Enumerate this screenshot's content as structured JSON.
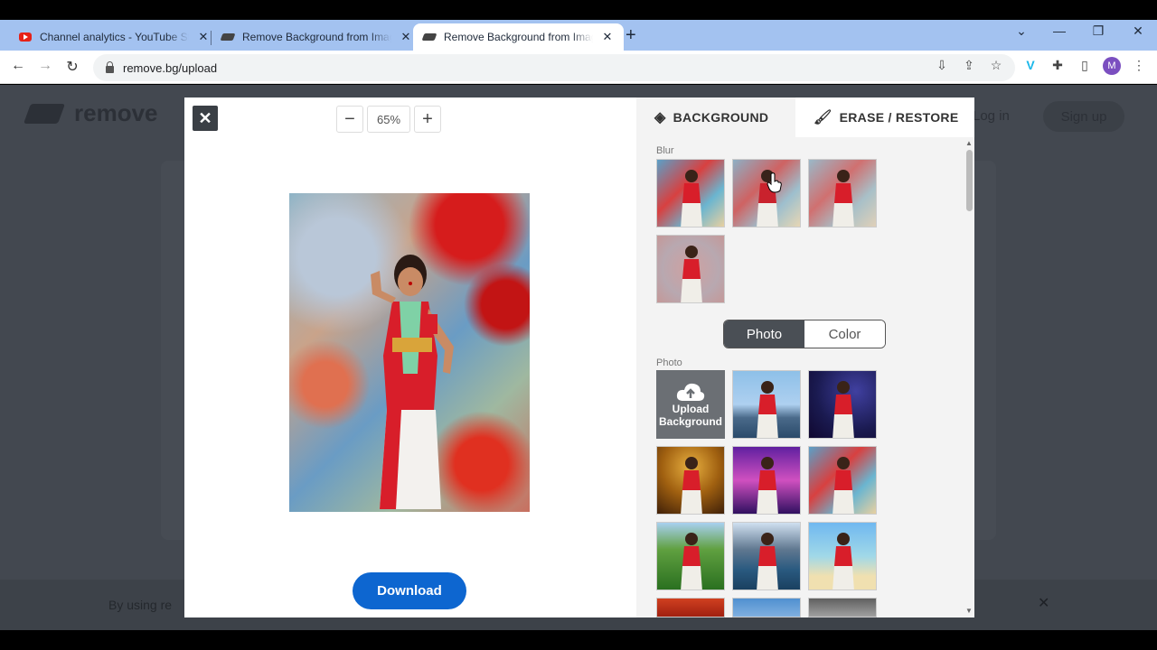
{
  "browser": {
    "tabs": [
      {
        "title": "Channel analytics - YouTube Studio",
        "favicon": "youtube-icon",
        "active": false
      },
      {
        "title": "Remove Background from Image",
        "favicon": "removebg-icon",
        "active": false
      },
      {
        "title": "Remove Background from Image",
        "favicon": "removebg-icon",
        "active": true
      }
    ],
    "url": "remove.bg/upload",
    "profile_initial": "M"
  },
  "site": {
    "logo_text": "remove",
    "login_label": "Log in",
    "signup_label": "Sign up",
    "cookie_text": "By using re"
  },
  "editor": {
    "zoom_value": "65%",
    "download_label": "Download",
    "tabs": {
      "background_label": "BACKGROUND",
      "erase_label": "ERASE / RESTORE"
    },
    "blur_section_label": "Blur",
    "toggle": {
      "photo_label": "Photo",
      "color_label": "Color",
      "selected": "Photo"
    },
    "photo_section_label": "Photo",
    "upload_label_line1": "Upload",
    "upload_label_line2": "Background",
    "photo_backgrounds": [
      "city-skyline",
      "starry-night",
      "autumn-forest",
      "purple-arches",
      "paint-strokes",
      "green-hills",
      "mountain-lake",
      "beach"
    ]
  },
  "colors": {
    "accent": "#0d66d0",
    "tabstrip": "#a3c2f0",
    "overlay": "#434850"
  }
}
